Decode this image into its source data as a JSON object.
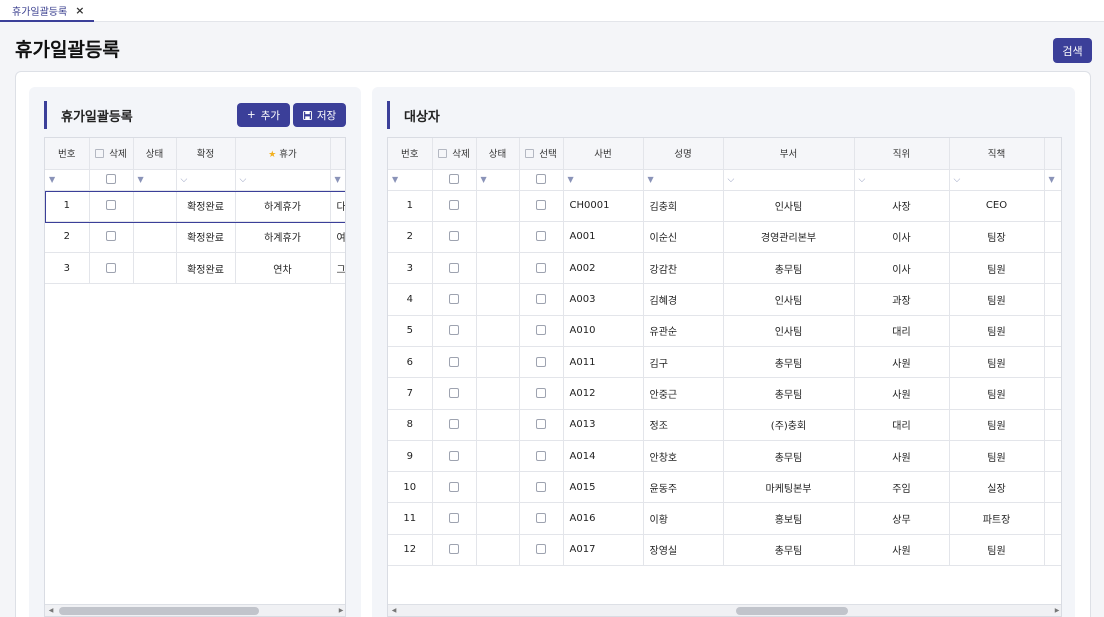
{
  "tab": {
    "label": "휴가일괄등록",
    "close": "×"
  },
  "page_title": "휴가일괄등록",
  "search_button": "검색",
  "left_panel": {
    "title": "휴가일괄등록",
    "add_button": "추가",
    "save_button": "저장",
    "headers": {
      "no": "번호",
      "delete": "삭제",
      "status": "상태",
      "confirm": "확정",
      "vacation": "휴가"
    },
    "rows": [
      {
        "no": "1",
        "confirm": "확정완료",
        "vacation": "하계휴가",
        "extra": "다"
      },
      {
        "no": "2",
        "confirm": "확정완료",
        "vacation": "하계휴가",
        "extra": "여"
      },
      {
        "no": "3",
        "confirm": "확정완료",
        "vacation": "연차",
        "extra": "그"
      }
    ]
  },
  "right_panel": {
    "title": "대상자",
    "headers": {
      "no": "번호",
      "delete": "삭제",
      "status": "상태",
      "select": "선택",
      "emp_no": "사번",
      "name": "성명",
      "dept": "부서",
      "rank": "직위",
      "role": "직책"
    },
    "rows": [
      {
        "no": "1",
        "emp_no": "CH0001",
        "name": "김충희",
        "dept": "인사팀",
        "rank": "사장",
        "role": "CEO"
      },
      {
        "no": "2",
        "emp_no": "A001",
        "name": "이순신",
        "dept": "경영관리본부",
        "rank": "이사",
        "role": "팀장"
      },
      {
        "no": "3",
        "emp_no": "A002",
        "name": "강감찬",
        "dept": "총무팀",
        "rank": "이사",
        "role": "팀원"
      },
      {
        "no": "4",
        "emp_no": "A003",
        "name": "김혜경",
        "dept": "인사팀",
        "rank": "과장",
        "role": "팀원"
      },
      {
        "no": "5",
        "emp_no": "A010",
        "name": "유관순",
        "dept": "인사팀",
        "rank": "대리",
        "role": "팀원"
      },
      {
        "no": "6",
        "emp_no": "A011",
        "name": "김구",
        "dept": "총무팀",
        "rank": "사원",
        "role": "팀원"
      },
      {
        "no": "7",
        "emp_no": "A012",
        "name": "안중근",
        "dept": "총무팀",
        "rank": "사원",
        "role": "팀원"
      },
      {
        "no": "8",
        "emp_no": "A013",
        "name": "정조",
        "dept": "(주)충회",
        "rank": "대리",
        "role": "팀원"
      },
      {
        "no": "9",
        "emp_no": "A014",
        "name": "안창호",
        "dept": "총무팀",
        "rank": "사원",
        "role": "팀원"
      },
      {
        "no": "10",
        "emp_no": "A015",
        "name": "윤동주",
        "dept": "마케팅본부",
        "rank": "주임",
        "role": "실장"
      },
      {
        "no": "11",
        "emp_no": "A016",
        "name": "이황",
        "dept": "홍보팀",
        "rank": "상무",
        "role": "파트장"
      },
      {
        "no": "12",
        "emp_no": "A017",
        "name": "장영실",
        "dept": "총무팀",
        "rank": "사원",
        "role": "팀원"
      }
    ]
  },
  "colors": {
    "accent": "#3b3f99",
    "star": "#f2b01e"
  }
}
